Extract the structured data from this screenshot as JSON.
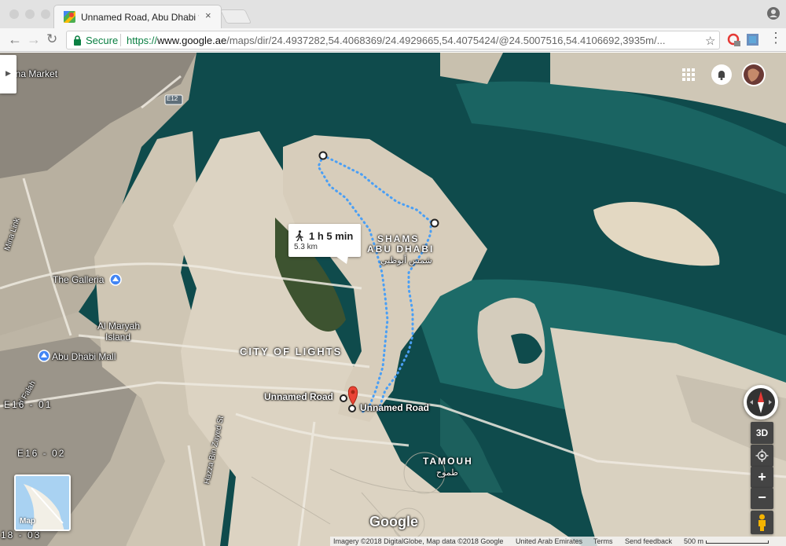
{
  "browser": {
    "tab_title": "Unnamed Road, Abu Dhabi to",
    "tab_close": "×",
    "secure_label": "Secure",
    "url_scheme": "https://",
    "url_host": "www.google.ae",
    "url_path": "/maps/dir/24.4937282,54.4068369/24.4929665,54.4075424/@24.5007516,54.4106692,3935m/..."
  },
  "route": {
    "mode": "walking",
    "duration": "1 h 5 min",
    "distance": "5.3 km"
  },
  "map_labels": {
    "market": "ina Market",
    "highway": "E12",
    "mina_link": "Mina Link",
    "galleria": "The Galleria",
    "al_maryah": "Al Maryah",
    "island": "Island",
    "abu_dhabi_mall": "Abu Dhabi Mall",
    "al_falah": "Al Falah",
    "e16_01": "E16 - 01",
    "e16_02": "E16 - 02",
    "e18_03": "18 - 03",
    "shams_1": "SHAMS",
    "shams_2": "ABU DHABI",
    "shams_ar": "شمس أبوظبي",
    "city_of_lights": "CITY OF LIGHTS",
    "unnamed_road_1": "Unnamed Road",
    "unnamed_road_2": "Unnamed Road",
    "hazza": "Hazza Bin Zayed St",
    "tamouh": "TAMOUH",
    "tamouh_ar": "طموح",
    "google": "Google"
  },
  "controls": {
    "three_d": "3D",
    "zoom_in": "+",
    "zoom_out": "−",
    "map_thumb": "Map"
  },
  "footer": {
    "imagery": "Imagery ©2018 DigitalGlobe, Map data ©2018 Google",
    "country": "United Arab Emirates",
    "terms": "Terms",
    "feedback": "Send feedback",
    "scale": "500 m"
  },
  "colors": {
    "water": "#0e4a4a",
    "land": "#d9cfbe",
    "route": "#4a9ff5",
    "pin": "#ea4335"
  }
}
